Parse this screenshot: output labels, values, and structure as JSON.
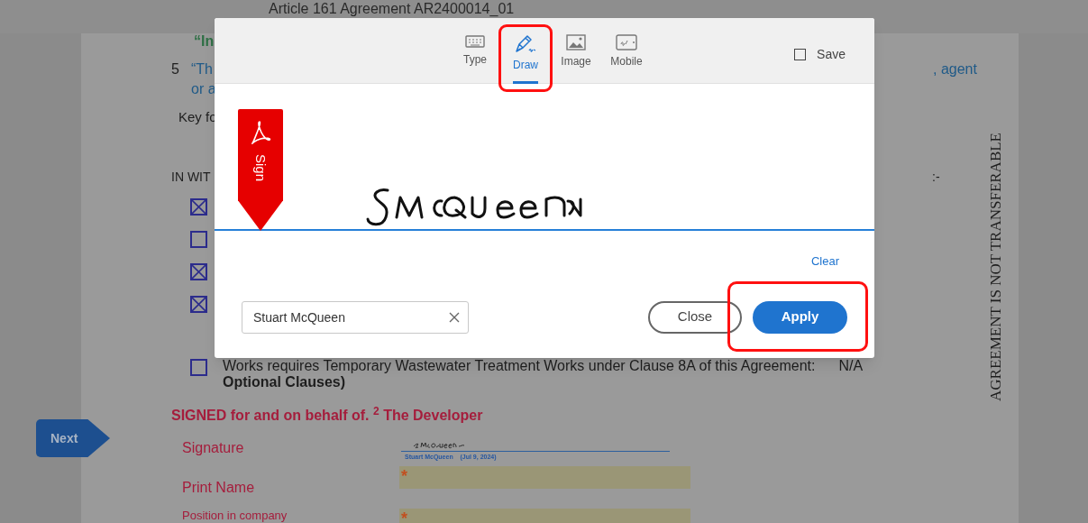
{
  "header": {
    "title": "Article 161 Agreement AR2400014_01"
  },
  "document": {
    "quote_fragment": "“In",
    "clause_number": "5",
    "clause_start": "“Th",
    "clause_end": ", agent",
    "clause_line2": "or a",
    "key_text": "Key fo",
    "witness_start": "IN WIT",
    "witness_end": ":-",
    "checkboxes": [
      {
        "checked": true
      },
      {
        "checked": false
      },
      {
        "checked": true
      },
      {
        "checked": true
      }
    ],
    "last_option": {
      "checked": false,
      "text": "Works requires Temporary Wastewater Treatment Works under Clause 8A of this Agreement:",
      "value": "N/A",
      "note": "Optional Clauses)"
    },
    "signed_heading": "SIGNED for and on behalf of. $^{2}$ The Developer",
    "signature_label": "Signature",
    "signature_caption": "Stuart McQueen    (Jul 9, 2024)",
    "fields": [
      {
        "label": "Print Name",
        "required_mark": "*"
      },
      {
        "label": "Position in company",
        "required_mark": "*"
      }
    ],
    "side_notice": "AGREEMENT IS NOT TRANSFERABLE"
  },
  "next_button": "Next",
  "modal": {
    "tabs": [
      {
        "label": "Type",
        "kind": "keyboard",
        "selected": false
      },
      {
        "label": "Draw",
        "kind": "pen",
        "selected": true
      },
      {
        "label": "Image",
        "kind": "image",
        "selected": false
      },
      {
        "label": "Mobile",
        "kind": "mobile",
        "selected": false
      }
    ],
    "save": {
      "label": "Save",
      "checked": false
    },
    "sign_flag": "Sign",
    "clear": "Clear",
    "name_value": "Stuart McQueen",
    "close": "Close",
    "apply": "Apply"
  }
}
